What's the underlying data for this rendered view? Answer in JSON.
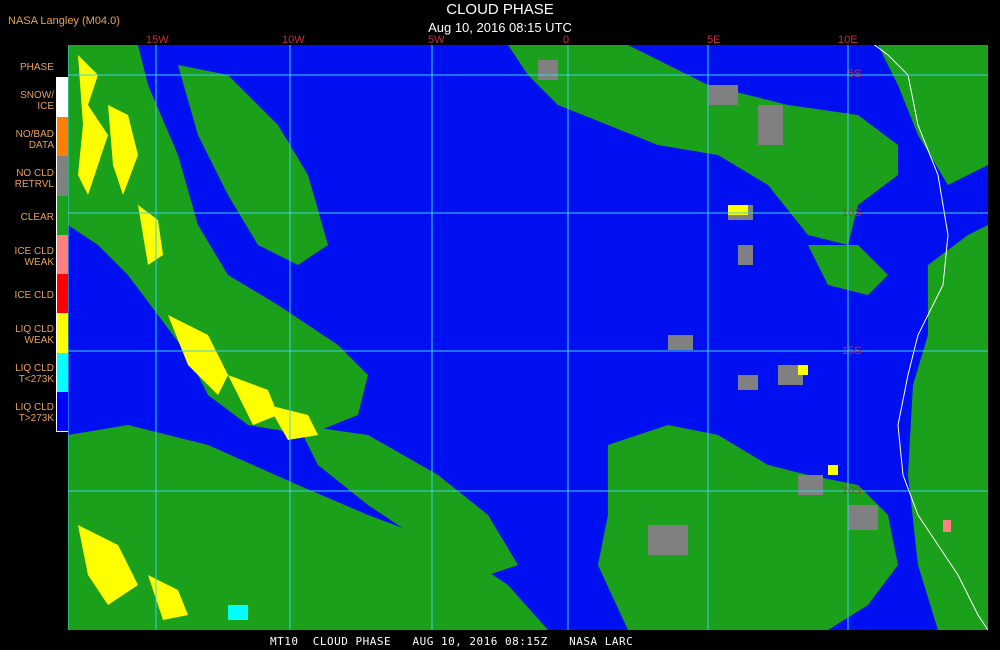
{
  "header": {
    "source": "NASA Langley (M04.0)",
    "title": "CLOUD PHASE",
    "subtitle": "Aug 10, 2016 08:15 UTC"
  },
  "footer": {
    "text": "MT10  CLOUD PHASE   AUG 10, 2016 08:15Z   NASA LARC"
  },
  "legend": {
    "title": "PHASE",
    "items": [
      {
        "label": "SNOW/\nICE",
        "color": "#ffffff"
      },
      {
        "label": "NO/BAD\nDATA",
        "color": "#ff8000"
      },
      {
        "label": "NO CLD\nRETRVL",
        "color": "#808080"
      },
      {
        "label": "CLEAR",
        "color": "#1aa01a"
      },
      {
        "label": "ICE CLD\nWEAK",
        "color": "#ff8080"
      },
      {
        "label": "ICE CLD",
        "color": "#ff0000"
      },
      {
        "label": "LIQ CLD\nWEAK",
        "color": "#ffff00"
      },
      {
        "label": "LIQ CLD\nT<273K",
        "color": "#00ffff"
      },
      {
        "label": "LIQ CLD\nT>273K",
        "color": "#0000ff"
      }
    ]
  },
  "map": {
    "longitude_labels": [
      "15W",
      "10W",
      "5W",
      "0",
      "5E",
      "10E"
    ],
    "latitude_labels": [
      "5S",
      "10S",
      "15S",
      "20S"
    ],
    "grid_color": "#40d0e0",
    "ocean_color": "#0010f0",
    "land_cloud_color": "#1aa01a",
    "coast_color": "#ffffff"
  }
}
